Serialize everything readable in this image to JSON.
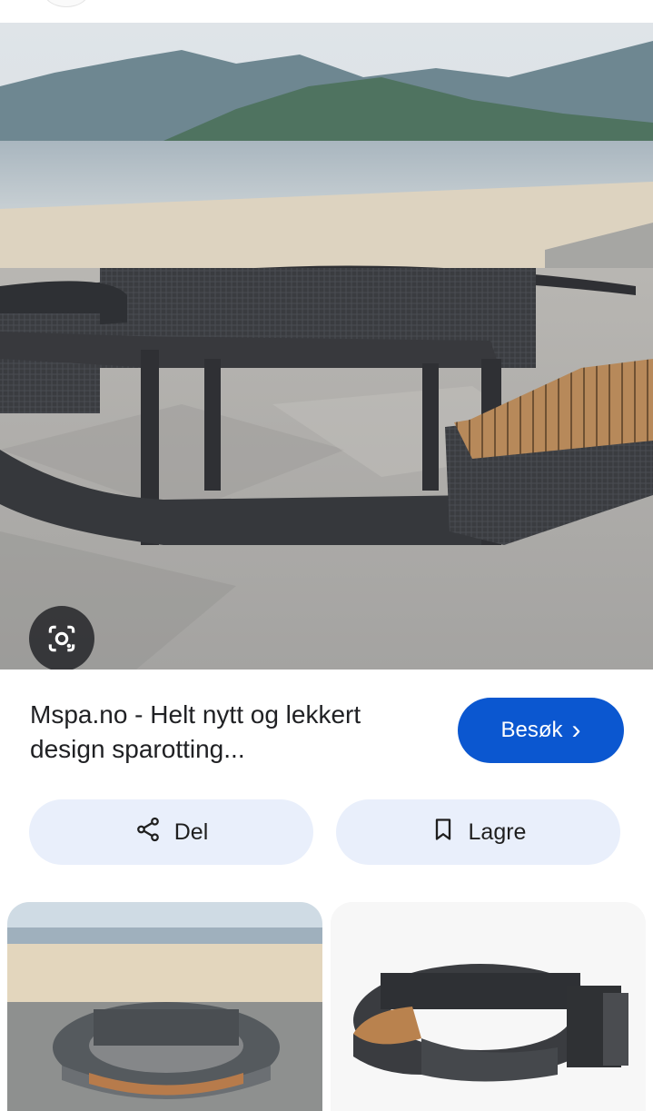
{
  "result": {
    "title": "Mspa.no - Helt nytt og lekkert design sparotting...",
    "visit_label": "Besøk",
    "visit_chevron": "›"
  },
  "actions": {
    "share_label": "Del",
    "save_label": "Lagre"
  },
  "icons": {
    "lens": "google-lens-icon",
    "share": "share-icon",
    "bookmark": "bookmark-icon",
    "chevron": "chevron-right-icon"
  },
  "colors": {
    "accent": "#0b57d0",
    "pill_bg": "#e9effb",
    "text": "#202124"
  }
}
